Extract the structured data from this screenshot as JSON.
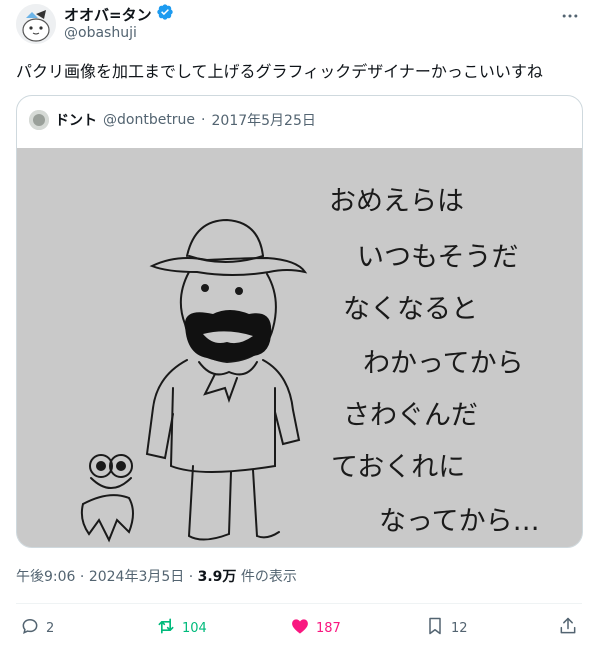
{
  "author": {
    "display_name": "オオバ=タン",
    "handle": "@obashuji",
    "verified": true
  },
  "tweet_text": "パクリ画像を加工までして上げるグラフィックデザイナーかっこいいすね",
  "quoted": {
    "name": "ドント",
    "handle": "@dontbetrue",
    "separator": "·",
    "date": "2017年5月25日",
    "image_lines": [
      "おめえらは",
      "いつもそうだ",
      "なくなると",
      "わかってから",
      "さわぐんだ",
      "ておくれに",
      "なってから…"
    ]
  },
  "meta": {
    "time": "午後9:06",
    "separator": "·",
    "date": "2024年3月5日",
    "views_value": "3.9万",
    "views_label": "件の表示"
  },
  "actions": {
    "replies": "2",
    "retweets": "104",
    "likes": "187",
    "bookmarks": "12"
  },
  "colors": {
    "text": "#0f1419",
    "secondary": "#536471",
    "verified": "#1d9bf0",
    "retweet": "#00ba7c",
    "like": "#f91880",
    "border": "#cfd9de"
  },
  "icons": [
    "more-icon",
    "verified-icon",
    "reply-icon",
    "retweet-icon",
    "like-icon",
    "bookmark-icon",
    "share-icon"
  ]
}
